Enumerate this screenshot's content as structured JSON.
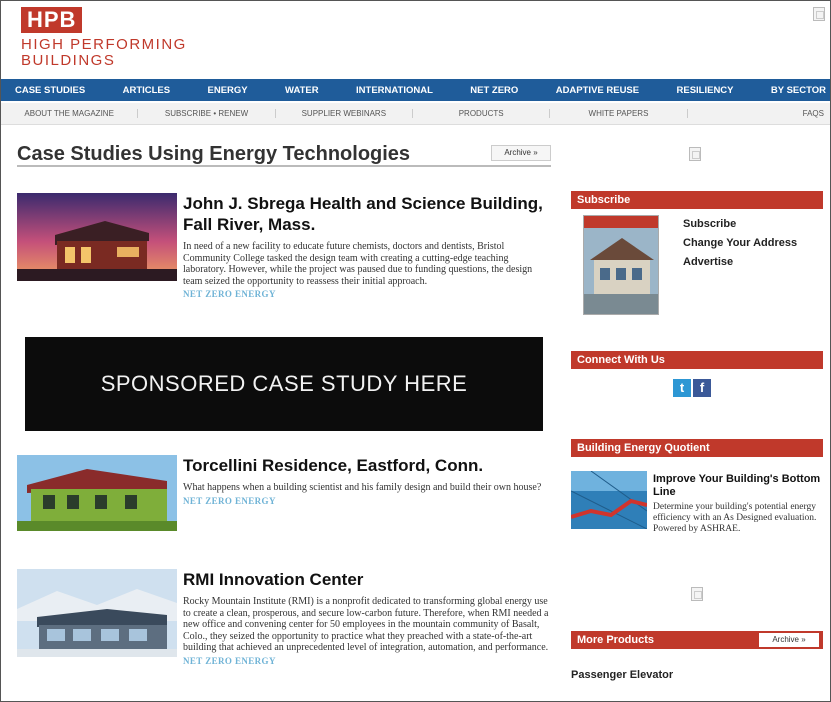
{
  "header": {
    "logo_mark": "HPB",
    "logo_line1": "HIGH PERFORMING",
    "logo_line2": "BUILDINGS"
  },
  "nav": [
    "CASE STUDIES",
    "ARTICLES",
    "ENERGY",
    "WATER",
    "INTERNATIONAL",
    "NET ZERO",
    "ADAPTIVE REUSE",
    "RESILIENCY",
    "BY SECTOR"
  ],
  "subnav": [
    "ABOUT THE MAGAZINE",
    "SUBSCRIBE • RENEW",
    "SUPPLIER WEBINARS",
    "PRODUCTS",
    "WHITE PAPERS",
    "FAQS"
  ],
  "main": {
    "title": "Case Studies Using Energy Technologies",
    "archive_label": "Archive »",
    "sponsored_label": "SPONSORED CASE STUDY HERE",
    "articles": [
      {
        "title": "John J. Sbrega Health and Science Building, Fall River, Mass.",
        "text": "In need of a new facility to educate future chemists, doctors and dentists, Bristol Community College tasked the design team with creating a cutting-edge teaching laboratory. However, while the project was paused due to funding questions, the design team seized the opportunity to reassess their initial approach.",
        "tag": "NET ZERO ENERGY"
      },
      {
        "title": "Torcellini Residence, Eastford, Conn.",
        "text": "What happens when a building scientist and his family design and build their own house?",
        "tag": "NET ZERO ENERGY"
      },
      {
        "title": "RMI Innovation Center",
        "text": "Rocky Mountain Institute (RMI) is a nonprofit dedicated to transforming global energy use to create a clean, prosperous, and secure low-carbon future. Therefore, when RMI needed a new office and convening center for 50 employees in the mountain community of Basalt, Colo., they seized the opportunity to practice what they preached with a state-of-the-art building that achieved an unprecedented level of integration, automation, and performance.",
        "tag": "NET ZERO ENERGY"
      }
    ]
  },
  "sidebar": {
    "subscribe": {
      "heading": "Subscribe",
      "links": [
        "Subscribe",
        "Change Your Address",
        "Advertise"
      ]
    },
    "connect": {
      "heading": "Connect With Us",
      "twitter_glyph": "t",
      "facebook_glyph": "f"
    },
    "beq": {
      "heading": "Building Energy Quotient",
      "title": "Improve Your Building's Bottom Line",
      "text": "Determine your building's potential energy efficiency with an As Designed evaluation. Powered by ASHRAE."
    },
    "more_products": {
      "heading": "More Products",
      "archive_label": "Archive »",
      "first_product": "Passenger Elevator"
    }
  }
}
